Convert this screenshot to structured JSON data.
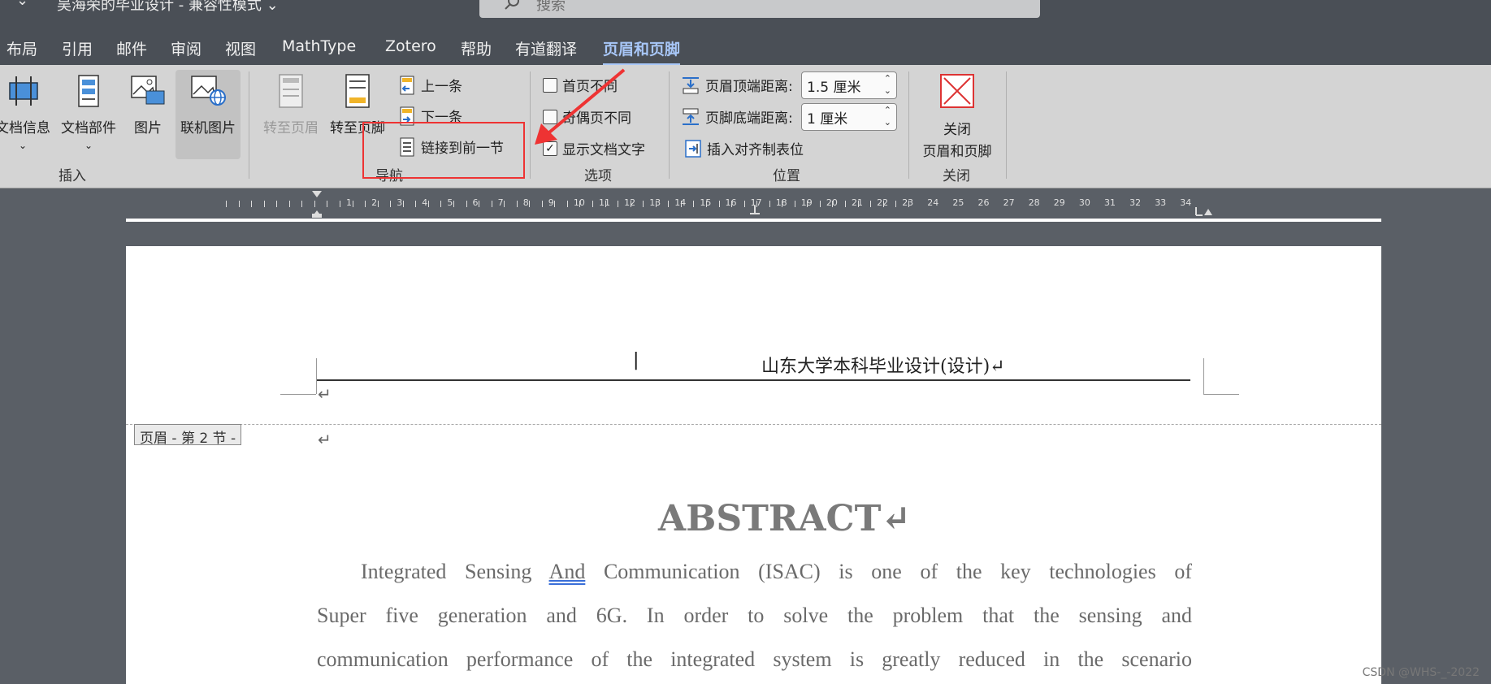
{
  "titlebar": {
    "chevron": "⌄",
    "doc_title": "吴海荣的毕业设计 - 兼容性模式 ⌄",
    "search_placeholder": "搜索"
  },
  "tabs": [
    {
      "label": "布局"
    },
    {
      "label": "引用"
    },
    {
      "label": "邮件"
    },
    {
      "label": "审阅"
    },
    {
      "label": "视图"
    },
    {
      "label": "MathType"
    },
    {
      "label": "Zotero"
    },
    {
      "label": "帮助"
    },
    {
      "label": "有道翻译"
    },
    {
      "label": "页眉和页脚",
      "active": true
    }
  ],
  "ribbon": {
    "insert": {
      "doc_info": "文档信息",
      "doc_parts": "文档部件",
      "picture": "图片",
      "online_picture": "联机图片",
      "group_label": "插入"
    },
    "navigation": {
      "goto_header": "转至页眉",
      "goto_footer": "转至页脚",
      "previous": "上一条",
      "next": "下一条",
      "link_to_previous": "链接到前一节",
      "group_label": "导航"
    },
    "options": {
      "different_first_page": "首页不同",
      "different_odd_even": "奇偶页不同",
      "show_document_text": "显示文档文字",
      "group_label": "选项"
    },
    "position": {
      "header_from_top_label": "页眉顶端距离:",
      "header_from_top_value": "1.5 厘米",
      "footer_from_bottom_label": "页脚底端距离:",
      "footer_from_bottom_value": "1 厘米",
      "insert_alignment_tab": "插入对齐制表位",
      "group_label": "位置"
    },
    "close": {
      "close_label_line1": "关闭",
      "close_label_line2": "页眉和页脚",
      "group_label": "关闭"
    },
    "colors": {
      "highlight": "#e33333",
      "active_tab": "#a8c7f8"
    }
  },
  "ruler": {
    "numbers": [
      "1",
      "2",
      "3",
      "4",
      "5",
      "6",
      "7",
      "8",
      "9",
      "10",
      "11",
      "12",
      "13",
      "14",
      "15",
      "16",
      "17",
      "18",
      "19",
      "20",
      "21",
      "22",
      "23",
      "24",
      "25",
      "26",
      "27",
      "28",
      "29",
      "30",
      "31",
      "32",
      "33",
      "34"
    ]
  },
  "page": {
    "header_text": "山东大学本科毕业设计(设计)↵",
    "header_tag": "页眉 - 第 2 节 -",
    "para_mark": "↵",
    "abstract_title": "ABSTRACT↵",
    "body": {
      "line1_before": "Integrated Sensing ",
      "line1_underlined": "And",
      "line1_after": " Communication (ISAC) is one of the key technologies of",
      "line2": "Super five generation and 6G. In order to solve the problem that the sensing and",
      "line3": "communication performance of the integrated system is greatly reduced in the scenario"
    }
  },
  "watermark": "CSDN @WHS-_-2022"
}
